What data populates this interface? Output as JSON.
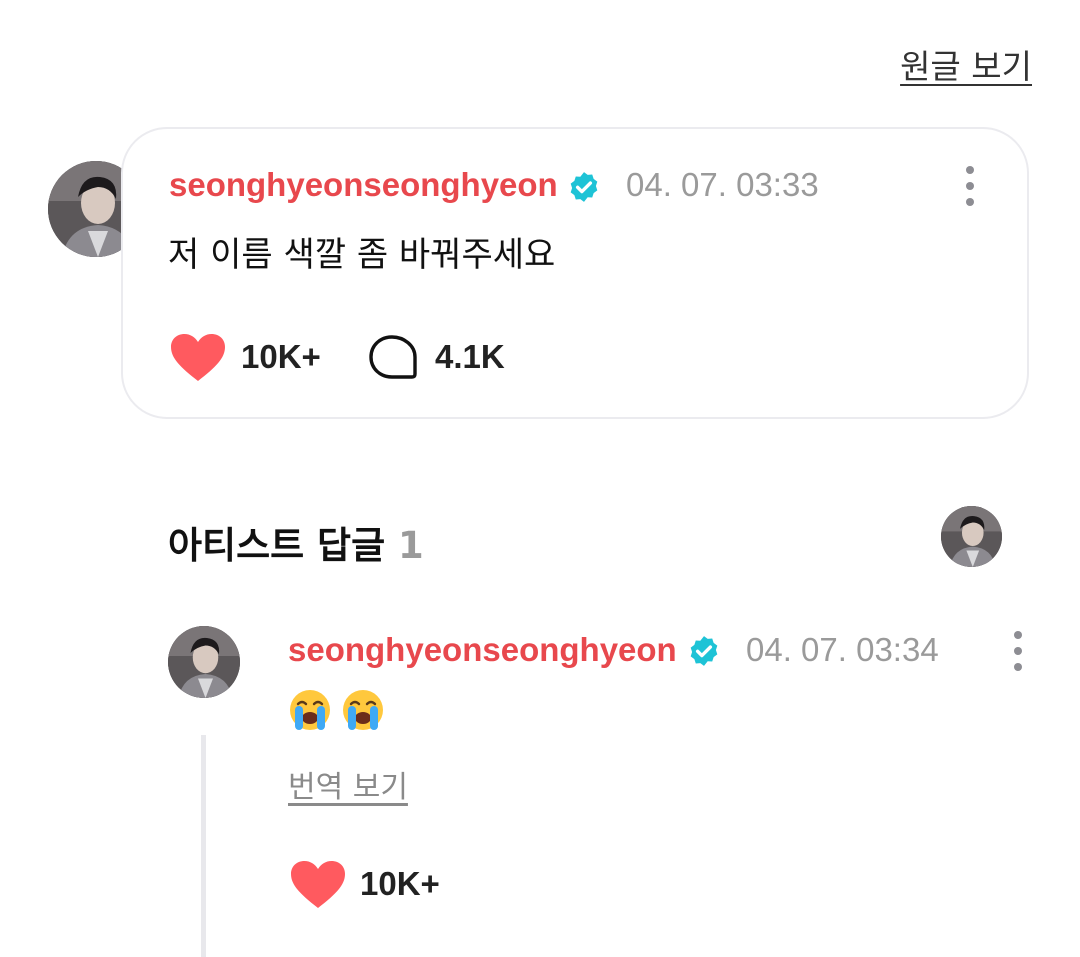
{
  "header": {
    "view_original_label": "원글 보기"
  },
  "post": {
    "username": "seonghyeonseonghyeon",
    "timestamp": "04. 07. 03:33",
    "text": "저 이름 색깔 좀 바꿔주세요",
    "like_count": "10K+",
    "comment_count": "4.1K"
  },
  "artist_replies": {
    "title": "아티스트 답글",
    "count": "1"
  },
  "reply": {
    "username": "seonghyeonseonghyeon",
    "timestamp": "04. 07. 03:34",
    "emoji_text": "😭😭",
    "translate_label": "번역 보기",
    "like_count": "10K+"
  },
  "colors": {
    "username": "#e8484d",
    "verified": "#1ec3d6",
    "heart": "#ff5a5f",
    "muted": "#9a9a9a"
  }
}
